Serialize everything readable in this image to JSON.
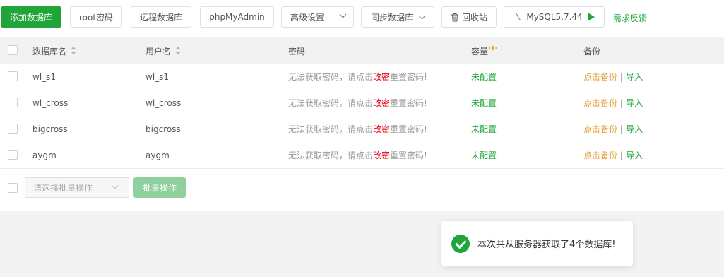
{
  "toolbar": {
    "add_db": "添加数据库",
    "root_password": "root密码",
    "remote_db": "远程数据库",
    "phpmyadmin": "phpMyAdmin",
    "advanced": "高级设置",
    "sync_db": "同步数据库",
    "recycle_bin": "回收站",
    "mysql_version": "MySQL5.7.44",
    "feedback": "需求反馈"
  },
  "table": {
    "headers": {
      "name": "数据库名",
      "user": "用户名",
      "password": "密码",
      "capacity": "容量",
      "backup": "备份"
    },
    "rows": [
      {
        "name": "wl_s1",
        "user": "wl_s1"
      },
      {
        "name": "wl_cross",
        "user": "wl_cross"
      },
      {
        "name": "bigcross",
        "user": "bigcross"
      },
      {
        "name": "aygm",
        "user": "aygm"
      }
    ],
    "password_prefix": "无法获取密码，请点击",
    "password_link": "改密",
    "password_suffix": "重置密码!",
    "capacity_status": "未配置",
    "backup_link": "点击备份",
    "backup_sep": "|",
    "import_link": "导入"
  },
  "batch": {
    "placeholder": "请选择批量操作",
    "button": "批量操作"
  },
  "toast": {
    "message": "本次共从服务器获取了4个数据库!"
  },
  "colors": {
    "accent": "#20a53a",
    "warning": "#e6a23c",
    "danger": "#e60012"
  }
}
